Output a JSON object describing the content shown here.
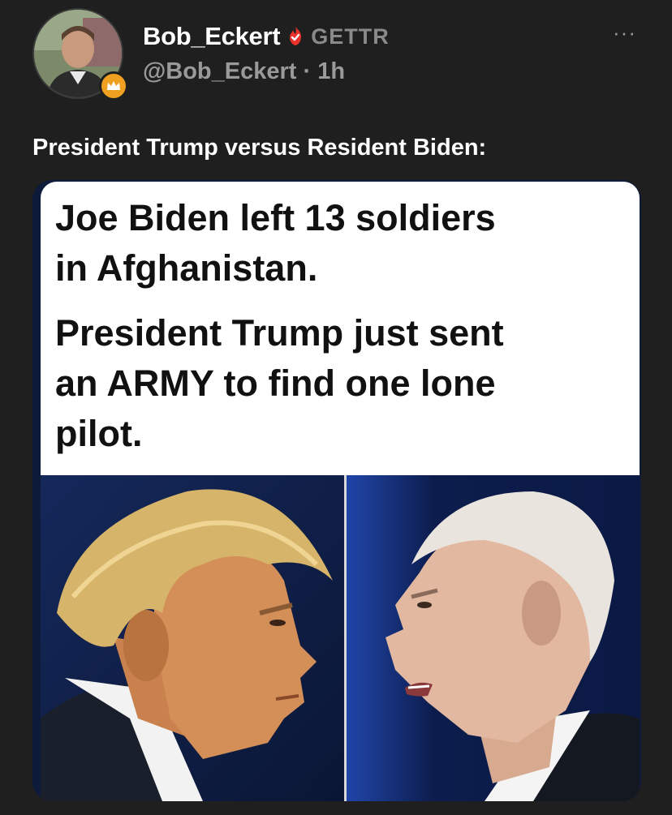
{
  "author": {
    "display_name": "Bob_Eckert",
    "platform": "GETTR",
    "handle_and_time": "@Bob_Eckert · 1h",
    "avatar_icon": "user-photo-avatar",
    "badge_icon": "crown-icon",
    "verified_icon": "verified-flame-icon",
    "verified_color": "#e8322b",
    "badge_color": "#f0a020"
  },
  "menu": {
    "more_label": "···"
  },
  "post": {
    "text": "President Trump versus Resident Biden:"
  },
  "media": {
    "line1a": "Joe Biden left 13 soldiers",
    "line1b": "in Afghanistan.",
    "line2a": "President Trump just sent",
    "line2b": "an ARMY to find one lone",
    "line2c": "pilot.",
    "left_photo": "trump-profile-photo",
    "right_photo": "biden-profile-photo"
  },
  "theme": {
    "background": "#1f1f1f",
    "text": "#ffffff",
    "muted": "#9a9a9a"
  }
}
